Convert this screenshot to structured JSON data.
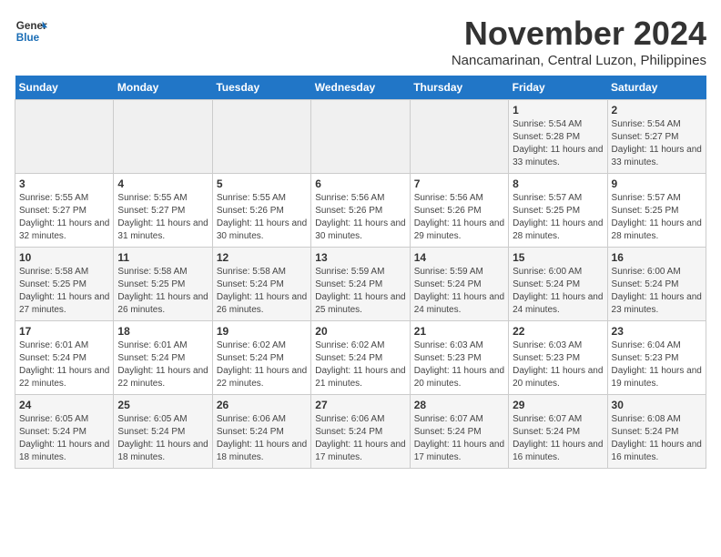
{
  "header": {
    "logo_text_general": "General",
    "logo_text_blue": "Blue",
    "month": "November 2024",
    "location": "Nancamarinan, Central Luzon, Philippines"
  },
  "weekdays": [
    "Sunday",
    "Monday",
    "Tuesday",
    "Wednesday",
    "Thursday",
    "Friday",
    "Saturday"
  ],
  "weeks": [
    [
      {
        "day": "",
        "info": ""
      },
      {
        "day": "",
        "info": ""
      },
      {
        "day": "",
        "info": ""
      },
      {
        "day": "",
        "info": ""
      },
      {
        "day": "",
        "info": ""
      },
      {
        "day": "1",
        "info": "Sunrise: 5:54 AM\nSunset: 5:28 PM\nDaylight: 11 hours and 33 minutes."
      },
      {
        "day": "2",
        "info": "Sunrise: 5:54 AM\nSunset: 5:27 PM\nDaylight: 11 hours and 33 minutes."
      }
    ],
    [
      {
        "day": "3",
        "info": "Sunrise: 5:55 AM\nSunset: 5:27 PM\nDaylight: 11 hours and 32 minutes."
      },
      {
        "day": "4",
        "info": "Sunrise: 5:55 AM\nSunset: 5:27 PM\nDaylight: 11 hours and 31 minutes."
      },
      {
        "day": "5",
        "info": "Sunrise: 5:55 AM\nSunset: 5:26 PM\nDaylight: 11 hours and 30 minutes."
      },
      {
        "day": "6",
        "info": "Sunrise: 5:56 AM\nSunset: 5:26 PM\nDaylight: 11 hours and 30 minutes."
      },
      {
        "day": "7",
        "info": "Sunrise: 5:56 AM\nSunset: 5:26 PM\nDaylight: 11 hours and 29 minutes."
      },
      {
        "day": "8",
        "info": "Sunrise: 5:57 AM\nSunset: 5:25 PM\nDaylight: 11 hours and 28 minutes."
      },
      {
        "day": "9",
        "info": "Sunrise: 5:57 AM\nSunset: 5:25 PM\nDaylight: 11 hours and 28 minutes."
      }
    ],
    [
      {
        "day": "10",
        "info": "Sunrise: 5:58 AM\nSunset: 5:25 PM\nDaylight: 11 hours and 27 minutes."
      },
      {
        "day": "11",
        "info": "Sunrise: 5:58 AM\nSunset: 5:25 PM\nDaylight: 11 hours and 26 minutes."
      },
      {
        "day": "12",
        "info": "Sunrise: 5:58 AM\nSunset: 5:24 PM\nDaylight: 11 hours and 26 minutes."
      },
      {
        "day": "13",
        "info": "Sunrise: 5:59 AM\nSunset: 5:24 PM\nDaylight: 11 hours and 25 minutes."
      },
      {
        "day": "14",
        "info": "Sunrise: 5:59 AM\nSunset: 5:24 PM\nDaylight: 11 hours and 24 minutes."
      },
      {
        "day": "15",
        "info": "Sunrise: 6:00 AM\nSunset: 5:24 PM\nDaylight: 11 hours and 24 minutes."
      },
      {
        "day": "16",
        "info": "Sunrise: 6:00 AM\nSunset: 5:24 PM\nDaylight: 11 hours and 23 minutes."
      }
    ],
    [
      {
        "day": "17",
        "info": "Sunrise: 6:01 AM\nSunset: 5:24 PM\nDaylight: 11 hours and 22 minutes."
      },
      {
        "day": "18",
        "info": "Sunrise: 6:01 AM\nSunset: 5:24 PM\nDaylight: 11 hours and 22 minutes."
      },
      {
        "day": "19",
        "info": "Sunrise: 6:02 AM\nSunset: 5:24 PM\nDaylight: 11 hours and 22 minutes."
      },
      {
        "day": "20",
        "info": "Sunrise: 6:02 AM\nSunset: 5:24 PM\nDaylight: 11 hours and 21 minutes."
      },
      {
        "day": "21",
        "info": "Sunrise: 6:03 AM\nSunset: 5:23 PM\nDaylight: 11 hours and 20 minutes."
      },
      {
        "day": "22",
        "info": "Sunrise: 6:03 AM\nSunset: 5:23 PM\nDaylight: 11 hours and 20 minutes."
      },
      {
        "day": "23",
        "info": "Sunrise: 6:04 AM\nSunset: 5:23 PM\nDaylight: 11 hours and 19 minutes."
      }
    ],
    [
      {
        "day": "24",
        "info": "Sunrise: 6:05 AM\nSunset: 5:24 PM\nDaylight: 11 hours and 18 minutes."
      },
      {
        "day": "25",
        "info": "Sunrise: 6:05 AM\nSunset: 5:24 PM\nDaylight: 11 hours and 18 minutes."
      },
      {
        "day": "26",
        "info": "Sunrise: 6:06 AM\nSunset: 5:24 PM\nDaylight: 11 hours and 18 minutes."
      },
      {
        "day": "27",
        "info": "Sunrise: 6:06 AM\nSunset: 5:24 PM\nDaylight: 11 hours and 17 minutes."
      },
      {
        "day": "28",
        "info": "Sunrise: 6:07 AM\nSunset: 5:24 PM\nDaylight: 11 hours and 17 minutes."
      },
      {
        "day": "29",
        "info": "Sunrise: 6:07 AM\nSunset: 5:24 PM\nDaylight: 11 hours and 16 minutes."
      },
      {
        "day": "30",
        "info": "Sunrise: 6:08 AM\nSunset: 5:24 PM\nDaylight: 11 hours and 16 minutes."
      }
    ]
  ]
}
